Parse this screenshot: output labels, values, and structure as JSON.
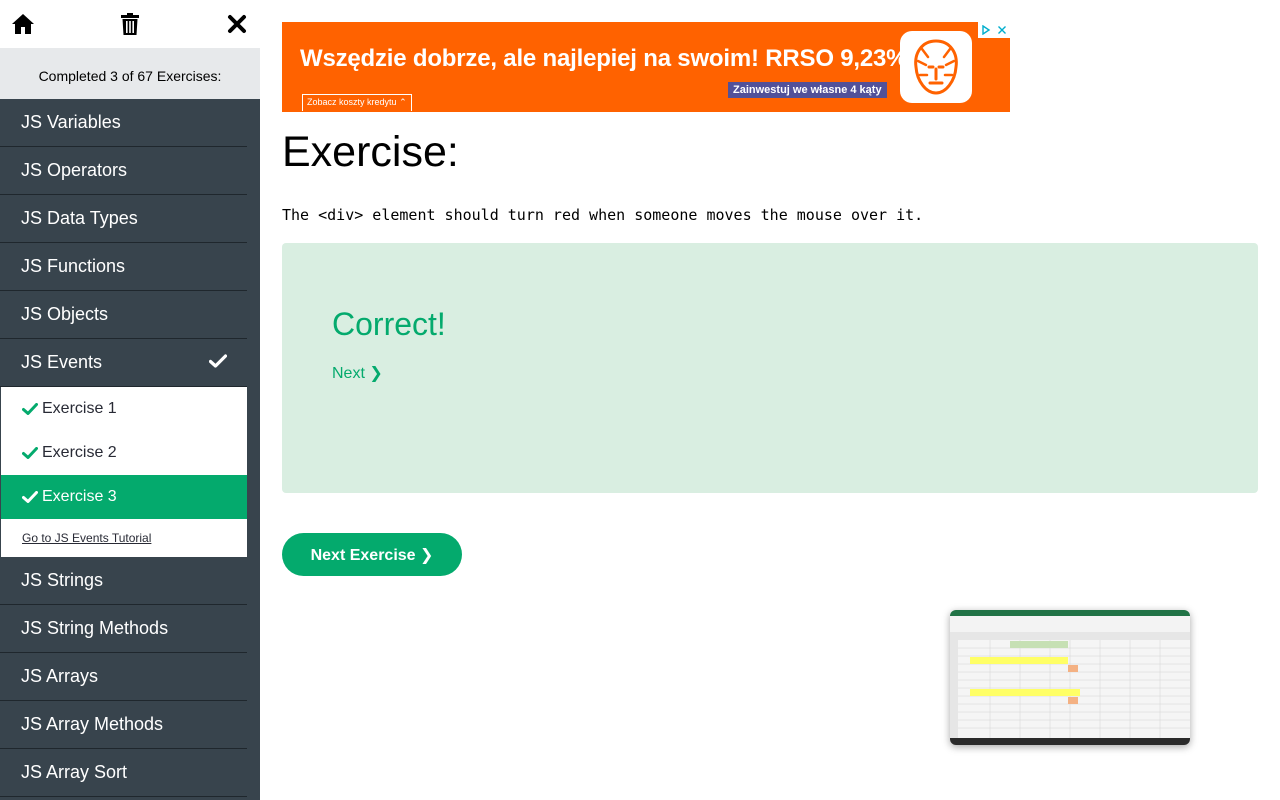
{
  "sidebar": {
    "top_icons": [
      "home-icon",
      "trash-icon",
      "close-icon"
    ],
    "progress_text": "Completed 3 of 67 Exercises:",
    "menu_before": [
      {
        "label": "JS Variables"
      },
      {
        "label": "JS Operators"
      },
      {
        "label": "JS Data Types"
      },
      {
        "label": "JS Functions"
      },
      {
        "label": "JS Objects"
      }
    ],
    "active_menu": {
      "label": "JS Events",
      "icon": "check-icon"
    },
    "sub_items": [
      {
        "label": "Exercise 1",
        "icon": "check-icon"
      },
      {
        "label": "Exercise 2",
        "icon": "check-icon"
      },
      {
        "label": "Exercise 3",
        "icon": "check-icon"
      }
    ],
    "tutorial_link": "Go to JS Events Tutorial",
    "menu_after": [
      {
        "label": "JS Strings"
      },
      {
        "label": "JS String Methods"
      },
      {
        "label": "JS Arrays"
      },
      {
        "label": "JS Array Methods"
      },
      {
        "label": "JS Array Sort"
      }
    ]
  },
  "ad": {
    "headline": "Wszędzie dobrze, ale najlepiej na swoim! RRSO 9,23%",
    "cta": "Zainwestuj we własne 4 kąty",
    "costs_label": "Zobacz koszty kredytu",
    "brand_color": "#ff6200"
  },
  "exercise": {
    "title": "Exercise:",
    "description": "The <div> element should turn red when someone moves the mouse over it.",
    "result_title": "Correct!",
    "next_link": "Next ❯",
    "next_exercise_button": "Next Exercise ❯"
  },
  "colors": {
    "accent": "#04aa6d",
    "sidebar_bg": "#38444d",
    "result_bg": "#d9eee1"
  }
}
